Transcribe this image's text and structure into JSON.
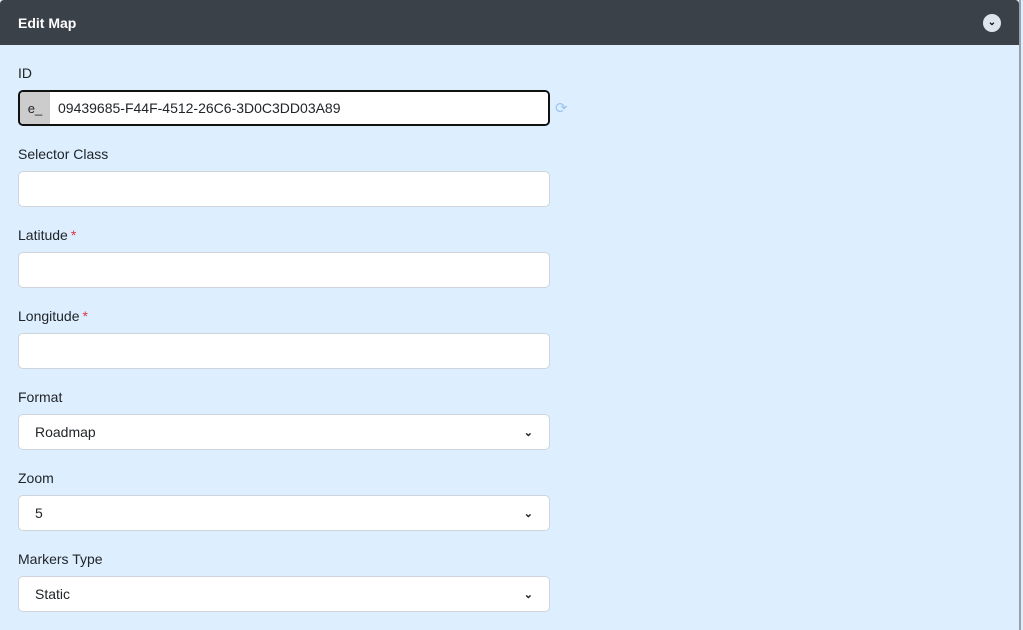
{
  "header": {
    "title": "Edit Map"
  },
  "form": {
    "id_label": "ID",
    "id_prefix": "e_",
    "id_value": "09439685-F44F-4512-26C6-3D0C3DD03A89",
    "selector_label": "Selector Class",
    "selector_value": "",
    "latitude_label": "Latitude",
    "latitude_value": "",
    "longitude_label": "Longitude",
    "longitude_value": "",
    "required_mark": "*",
    "format_label": "Format",
    "format_value": "Roadmap",
    "zoom_label": "Zoom",
    "zoom_value": "5",
    "markers_label": "Markers Type",
    "markers_value": "Static"
  }
}
